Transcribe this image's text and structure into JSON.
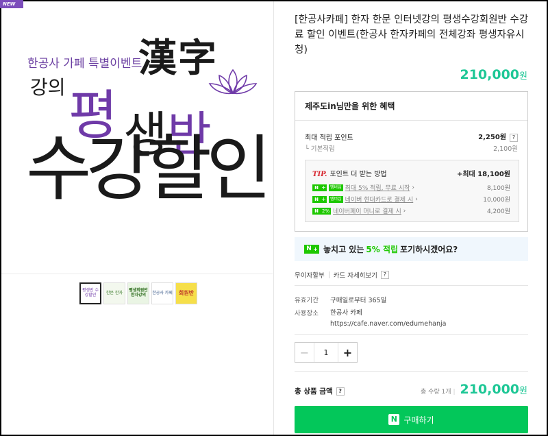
{
  "badge": "NEW",
  "poster": {
    "subtitle": "한공사 가페 특별이벤트",
    "lecture": "강의",
    "hanja": "漢字",
    "pyeong": "평",
    "saeng": "생",
    "ban": "반",
    "discount": "수강할인"
  },
  "thumbnails": [
    {
      "text": "평생반 수강할인"
    },
    {
      "text": "한문 한자"
    },
    {
      "text": "평생회원반 한자강의"
    },
    {
      "text": "한공사 카페"
    },
    {
      "text": "회원반"
    }
  ],
  "product": {
    "title": "[한공사카페] 한자 한문 인터넷강의 평생수강회원반 수강료 할인 이벤트(한공사 한자카페의 전체강좌 평생자유시청)",
    "price": "210,000",
    "currency": "원"
  },
  "benefit": {
    "heading": "제주도in님만을 위한 혜택",
    "max_points_label": "최대 적립 포인트",
    "max_points_value": "2,250원",
    "basic_label": "기본적립",
    "basic_value": "2,100원",
    "tip_label": "TIP.",
    "tip_text": "포인트 더 받는 방법",
    "tip_total": "+최대 18,100원",
    "tips": [
      {
        "badge": "멤버십",
        "text": "최대 5% 적립, 무료 시작",
        "value": "8,100원"
      },
      {
        "badge": "멤버십",
        "text": "네이버 현대카드로 결제 시",
        "value": "10,000원"
      },
      {
        "badge": "2%",
        "text": "네이버페이 머니로 결제 시",
        "value": "4,200원"
      }
    ]
  },
  "banner": {
    "pre": "놓치고 있는",
    "highlight": "5% 적립",
    "post": "포기하시겠어요?"
  },
  "installment": {
    "label": "무이자할부",
    "card_detail": "카드 자세히보기"
  },
  "validity": {
    "label": "유효기간",
    "value": "구매일로부터 365일"
  },
  "location": {
    "label": "사용장소",
    "name": "한공사 카페",
    "url": "https://cafe.naver.com/edumehanja"
  },
  "quantity": {
    "value": "1"
  },
  "total": {
    "label": "총 상품 금액",
    "count": "총 수량 1개",
    "price": "210,000",
    "currency": "원"
  },
  "buy_button": "구매하기",
  "colors": {
    "accent": "#1ec796",
    "buy": "#03c75a",
    "poster_purple": "#6f3aa8"
  }
}
